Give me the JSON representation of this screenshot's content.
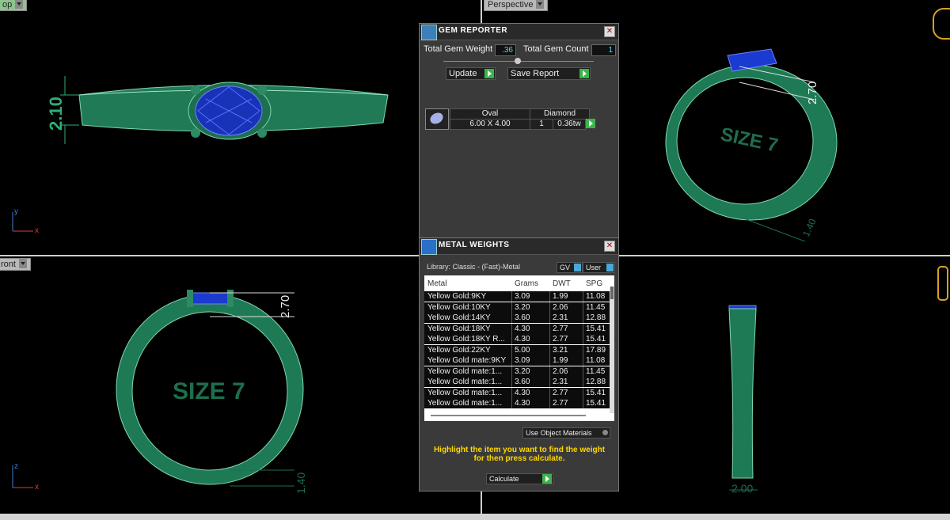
{
  "viewports": {
    "top_left_label": "op",
    "top_right_label": "Perspective",
    "bottom_left_label": "ront",
    "top_ring_dim": "2.10",
    "persp_ring_dim": "2.70",
    "persp_size_text": "SIZE 7",
    "persp_dim_bottom": "1.40",
    "front_size_text": "SIZE 7",
    "front_dim_top": "2.70",
    "front_dim_bottom": "1.40",
    "side_dim_bottom": "2.00",
    "axis_y": "y",
    "axis_x": "x",
    "axis_z": "z"
  },
  "gem_reporter": {
    "title": "GEM REPORTER",
    "total_weight_label": "Total Gem Weight",
    "total_weight_value": ".36",
    "total_count_label": "Total Gem Count",
    "total_count_value": "1",
    "update_label": "Update",
    "save_label": "Save Report",
    "gem": {
      "shape": "Oval",
      "size": "6.00 X 4.00",
      "material": "Diamond",
      "count": "1",
      "weight": "0.36tw"
    }
  },
  "metal_weights": {
    "title": "METAL WEIGHTS",
    "library": "Library: Classic - (Fast)-Metal",
    "gv_label": "GV",
    "user_label": "User",
    "columns": [
      "Metal",
      "Grams",
      "DWT",
      "SPG"
    ],
    "rows": [
      [
        "Yellow Gold:9KY",
        "3.09",
        "1.99",
        "11.08"
      ],
      [
        "Yellow Gold:10KY",
        "3.20",
        "2.06",
        "11.45"
      ],
      [
        "Yellow Gold:14KY",
        "3.60",
        "2.31",
        "12.88"
      ],
      [
        "Yellow Gold:18KY",
        "4.30",
        "2.77",
        "15.41"
      ],
      [
        "Yellow Gold:18KY R...",
        "4.30",
        "2.77",
        "15.41"
      ],
      [
        "Yellow Gold:22KY",
        "5.00",
        "3.21",
        "17.89"
      ],
      [
        "Yellow Gold mate:9KY",
        "3.09",
        "1.99",
        "11.08"
      ],
      [
        "Yellow Gold mate:1...",
        "3.20",
        "2.06",
        "11.45"
      ],
      [
        "Yellow Gold mate:1...",
        "3.60",
        "2.31",
        "12.88"
      ],
      [
        "Yellow Gold mate:1...",
        "4.30",
        "2.77",
        "15.41"
      ],
      [
        "Yellow Gold mate:1...",
        "4.30",
        "2.77",
        "15.41"
      ]
    ],
    "use_object_label": "Use Object Materials",
    "hint_line1": "Highlight the item you want to find the weight",
    "hint_line2": "for then press calculate.",
    "calculate_label": "Calculate"
  }
}
